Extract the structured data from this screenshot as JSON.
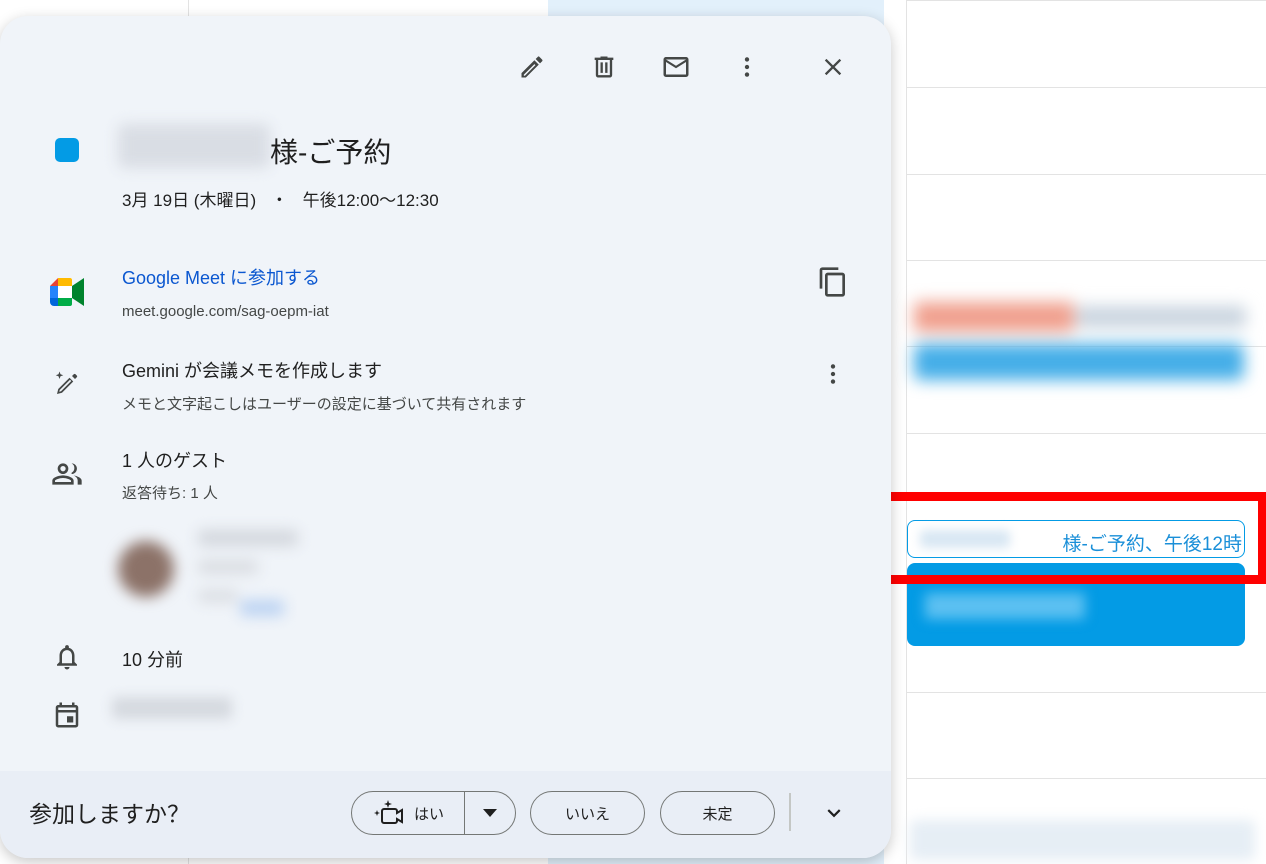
{
  "event": {
    "title_suffix": "様-ご予約",
    "date": "3月 19日 (木曜日)",
    "separator": "・",
    "time": "午後12:00～12:30",
    "color": "#039be5"
  },
  "meet": {
    "link_label": "Google Meet に参加する",
    "url": "meet.google.com/sag-oepm-iat"
  },
  "gemini": {
    "title": "Gemini が会議メモを作成します",
    "subtitle": "メモと文字起こしはユーザーの設定に基づいて共有されます"
  },
  "guests": {
    "title": "1 人のゲスト",
    "status": "返答待ち: 1 人"
  },
  "reminder": {
    "text": "10 分前"
  },
  "rsvp": {
    "question": "参加しますか？",
    "yes": "はい",
    "no": "いいえ",
    "maybe": "未定"
  },
  "calendar_chip": {
    "text": "様-ご予約、午後12時"
  },
  "icons": {
    "edit": "pencil-icon",
    "delete": "trash-icon",
    "email": "mail-icon",
    "more": "more-vert-icon",
    "close": "close-icon",
    "meet": "google-meet-icon",
    "copy": "copy-icon",
    "gemini": "gemini-pen-icon",
    "guests": "people-icon",
    "reminder": "bell-icon",
    "calendar": "calendar-icon"
  }
}
